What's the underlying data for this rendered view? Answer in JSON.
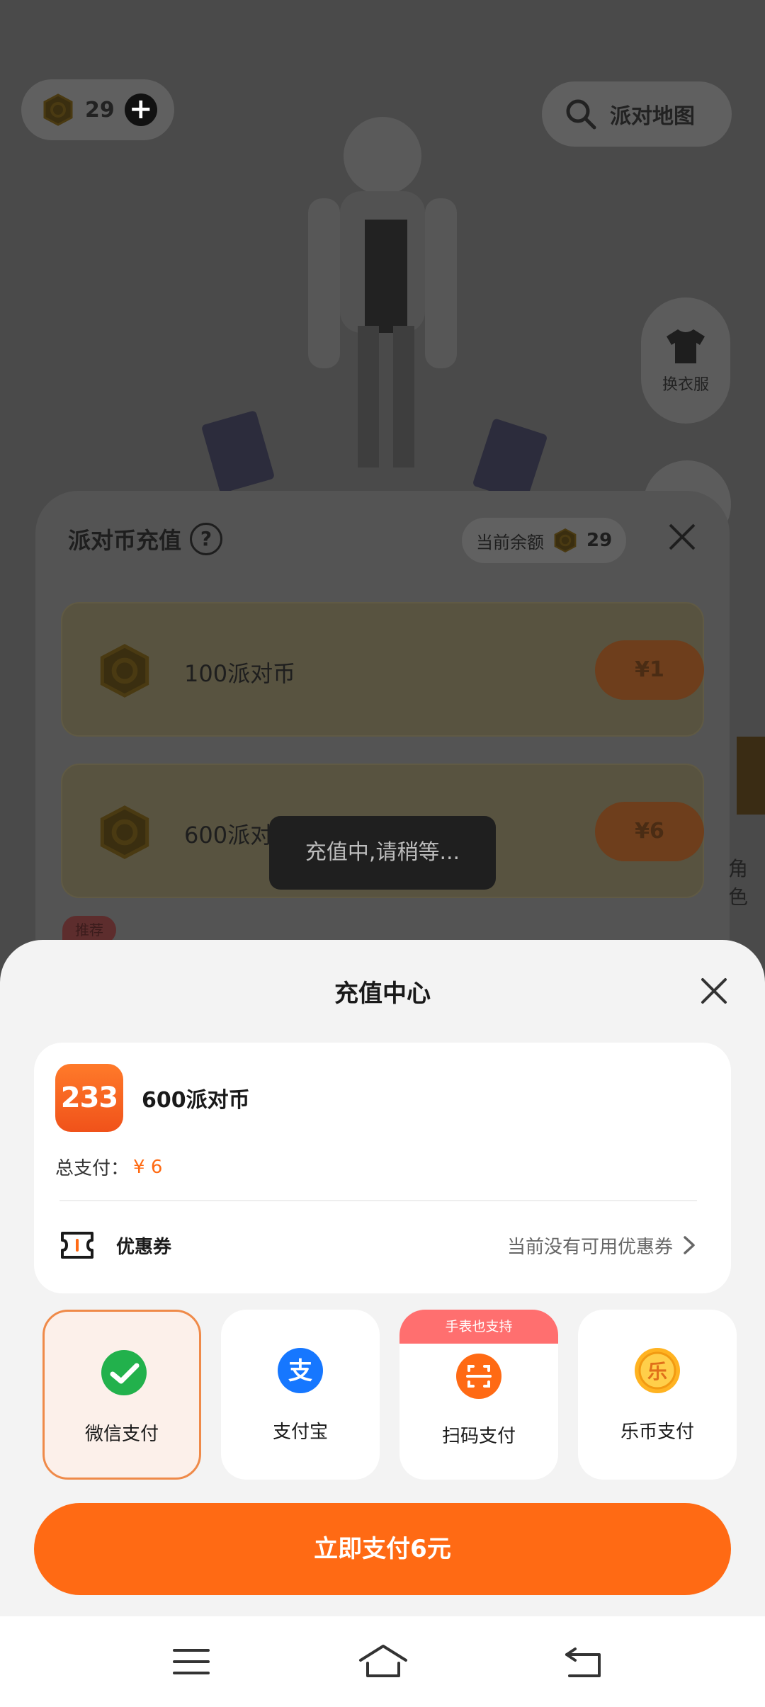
{
  "scene": {
    "coin_count": "29",
    "map_button_label": "派对地图",
    "wardrobe_label": "换衣服",
    "side_text": "角色"
  },
  "recharge_panel": {
    "title": "派对币充值",
    "help_icon": "question-icon",
    "balance_label": "当前余额",
    "balance_value": "29",
    "packs": [
      {
        "name": "100派对币",
        "price": "¥1"
      },
      {
        "name": "600派对币",
        "price": "¥6"
      }
    ],
    "recommend_badge": "推荐"
  },
  "toast": {
    "text": "充值中,请稍等..."
  },
  "payment_sheet": {
    "title": "充值中心",
    "app_logo_text": "233",
    "product_name": "600派对币",
    "total_label": "总支付：",
    "total_amount": "¥ 6",
    "coupon_label": "优惠券",
    "coupon_status": "当前没有可用优惠券",
    "methods": [
      {
        "label": "微信支付",
        "icon": "wechat-pay-icon",
        "selected": true
      },
      {
        "label": "支付宝",
        "icon": "alipay-icon",
        "selected": false
      },
      {
        "label": "扫码支付",
        "icon": "scan-code-icon",
        "selected": false,
        "tag": "手表也支持"
      },
      {
        "label": "乐币支付",
        "icon": "lebi-icon",
        "selected": false
      }
    ],
    "pay_button": "立即支付6元"
  },
  "nav_bar": {
    "items": [
      "menu-icon",
      "home-icon",
      "back-icon"
    ]
  },
  "colors": {
    "accent": "#ff6a14",
    "selected_border": "#ef8a49",
    "selected_bg": "#fcf0ea",
    "tag_bg": "#ff6f6f",
    "wechat_green": "#22b14c",
    "alipay_blue": "#1677ff"
  }
}
